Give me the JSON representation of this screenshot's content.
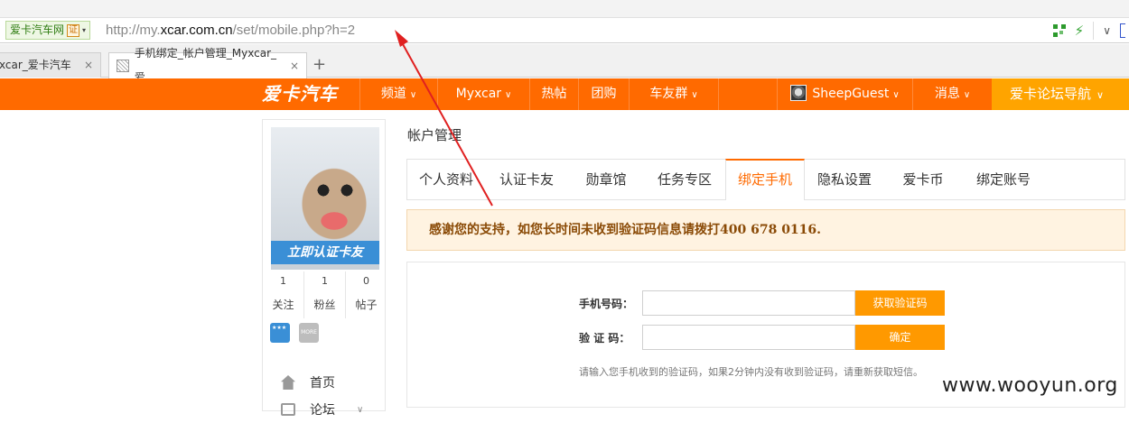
{
  "browser": {
    "site_badge": "爱卡汽车网",
    "cert": "证",
    "url_prefix": "http://my.",
    "url_host": "xcar.com.cn",
    "url_path": "/set/mobile.php?h=2",
    "tabs": [
      {
        "label": "xcar_爱卡汽车"
      },
      {
        "label": "手机绑定_帐户管理_Myxcar_爱"
      }
    ],
    "close_glyph": "×",
    "new_tab_glyph": "+"
  },
  "nav": {
    "logo": "爱卡汽车",
    "items": [
      {
        "label": "频道",
        "caret": "∨"
      },
      {
        "label": "Myxcar",
        "caret": "∨"
      },
      {
        "label": "热帖"
      },
      {
        "label": "团购"
      },
      {
        "label": "车友群",
        "caret": "∨"
      }
    ],
    "user": {
      "name": "SheepGuest",
      "caret": "∨"
    },
    "messages": {
      "label": "消息",
      "caret": "∨"
    },
    "guide": {
      "label": "爱卡论坛导航",
      "caret": "∨"
    }
  },
  "sidebar": {
    "verify_banner": "立即认证卡友",
    "stats": [
      {
        "count": "1",
        "label": "关注"
      },
      {
        "count": "1",
        "label": "粉丝"
      },
      {
        "count": "0",
        "label": "帖子"
      }
    ],
    "more_badge": "MORE",
    "menu": [
      {
        "label": "首页"
      },
      {
        "label": "论坛",
        "caret": "∨"
      }
    ]
  },
  "main": {
    "title": "帐户管理",
    "tabs": [
      {
        "label": "个人资料"
      },
      {
        "label": "认证卡友"
      },
      {
        "label": "勋章馆"
      },
      {
        "label": "任务专区"
      },
      {
        "label": "绑定手机"
      },
      {
        "label": "隐私设置"
      },
      {
        "label": "爱卡币"
      },
      {
        "label": "绑定账号"
      }
    ],
    "notice": "感谢您的支持，如您长时间未收到验证码信息请拨打400 678 0116.",
    "form": {
      "phone_label": "手机号码：",
      "phone_value": "",
      "get_code_button": "获取验证码",
      "code_label": "验 证 码：",
      "code_value": "",
      "confirm_button": "确定",
      "hint": "请输入您手机收到的验证码，如果2分钟内没有收到验证码，请重新获取短信。"
    }
  },
  "watermark": "www.wooyun.org",
  "colors": {
    "accent": "#ff6a00",
    "guide": "#ffa400",
    "button": "#ff9900",
    "arrow": "#e02020"
  }
}
